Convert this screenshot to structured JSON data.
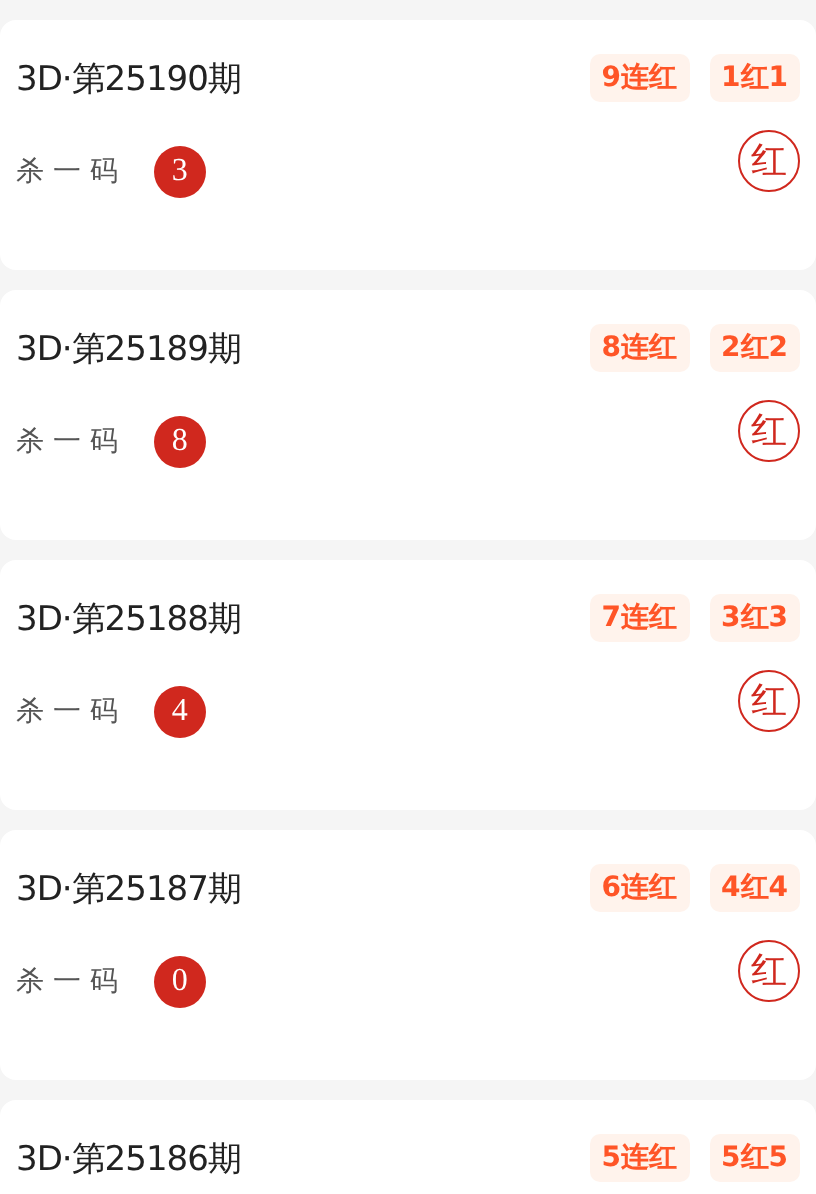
{
  "records": [
    {
      "issue": "3D·第25190期",
      "tags": [
        "9连红",
        "1红1"
      ],
      "kill_label": "杀 一 码",
      "kill_number": "3",
      "result": "红"
    },
    {
      "issue": "3D·第25189期",
      "tags": [
        "8连红",
        "2红2"
      ],
      "kill_label": "杀 一 码",
      "kill_number": "8",
      "result": "红"
    },
    {
      "issue": "3D·第25188期",
      "tags": [
        "7连红",
        "3红3"
      ],
      "kill_label": "杀 一 码",
      "kill_number": "4",
      "result": "红"
    },
    {
      "issue": "3D·第25187期",
      "tags": [
        "6连红",
        "4红4"
      ],
      "kill_label": "杀 一 码",
      "kill_number": "0",
      "result": "红"
    },
    {
      "issue": "3D·第25186期",
      "tags": [
        "5连红",
        "5红5"
      ]
    }
  ]
}
